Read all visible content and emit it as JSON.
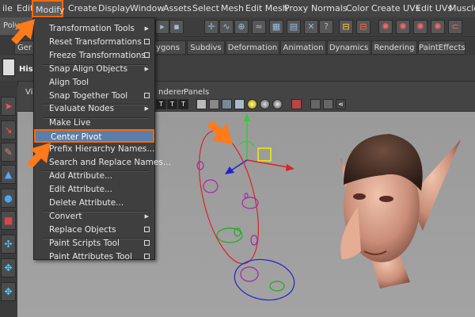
{
  "menubar": {
    "items": [
      {
        "label": "ile"
      },
      {
        "label": "Edit"
      },
      {
        "label": "Modify"
      },
      {
        "label": "Create"
      },
      {
        "label": "Display"
      },
      {
        "label": "Window"
      },
      {
        "label": "Assets"
      },
      {
        "label": "Select"
      },
      {
        "label": "Mesh"
      },
      {
        "label": "Edit Mesh"
      },
      {
        "label": "Proxy"
      },
      {
        "label": "Normals"
      },
      {
        "label": "Color"
      },
      {
        "label": "Create UVs"
      },
      {
        "label": "Edit UVs"
      },
      {
        "label": "Muscle"
      }
    ],
    "active_label": "Modify"
  },
  "shelf": {
    "mode_label": "Polygo"
  },
  "shelf_tabs": {
    "general": "Ger",
    "items": [
      {
        "label": "ygons"
      },
      {
        "label": "Subdivs"
      },
      {
        "label": "Deformation"
      },
      {
        "label": "Animation"
      },
      {
        "label": "Dynamics"
      },
      {
        "label": "Rendering"
      },
      {
        "label": "PaintEffects"
      }
    ]
  },
  "shelf2": {
    "his_label": "His"
  },
  "panel": {
    "menu": [
      {
        "label": "Vie"
      },
      {
        "label": "nderer"
      },
      {
        "label": "Panels"
      }
    ],
    "toolbar_icons": [
      "T",
      "T",
      "T"
    ]
  },
  "modify_menu": {
    "items": [
      {
        "label": "Transformation Tools",
        "suffix": "arrow"
      },
      {
        "label": "Reset Transformations",
        "suffix": "box"
      },
      {
        "label": "Freeze Transformations",
        "suffix": "box"
      },
      {
        "label": "Snap Align Objects",
        "suffix": "arrow"
      },
      {
        "label": "Align Tool",
        "suffix": ""
      },
      {
        "label": "Snap Together Tool",
        "suffix": "box"
      },
      {
        "label": "Evaluate Nodes",
        "suffix": "arrow"
      },
      {
        "label": "Make Live",
        "suffix": ""
      },
      {
        "label": "Center Pivot",
        "suffix": "",
        "selected": true
      },
      {
        "label": "Prefix Hierarchy Names...",
        "suffix": ""
      },
      {
        "label": "Search and Replace Names...",
        "suffix": ""
      },
      {
        "label": "Add Attribute...",
        "suffix": ""
      },
      {
        "label": "Edit Attribute...",
        "suffix": ""
      },
      {
        "label": "Delete Attribute...",
        "suffix": ""
      },
      {
        "label": "Convert",
        "suffix": "arrow"
      },
      {
        "label": "Replace Objects",
        "suffix": "box"
      },
      {
        "label": "Paint Scripts Tool",
        "suffix": "box"
      },
      {
        "label": "Paint Attributes Tool",
        "suffix": "box"
      }
    ]
  },
  "colors": {
    "highlight": "#ff6a00",
    "selected_item": "#5a7daa",
    "viewport": "#a0a0a0"
  },
  "icons": {
    "tutorial_arrows": "orange-arrow-icon",
    "manipulator": "move-manipulator-icon",
    "model": "elf-head-model"
  }
}
